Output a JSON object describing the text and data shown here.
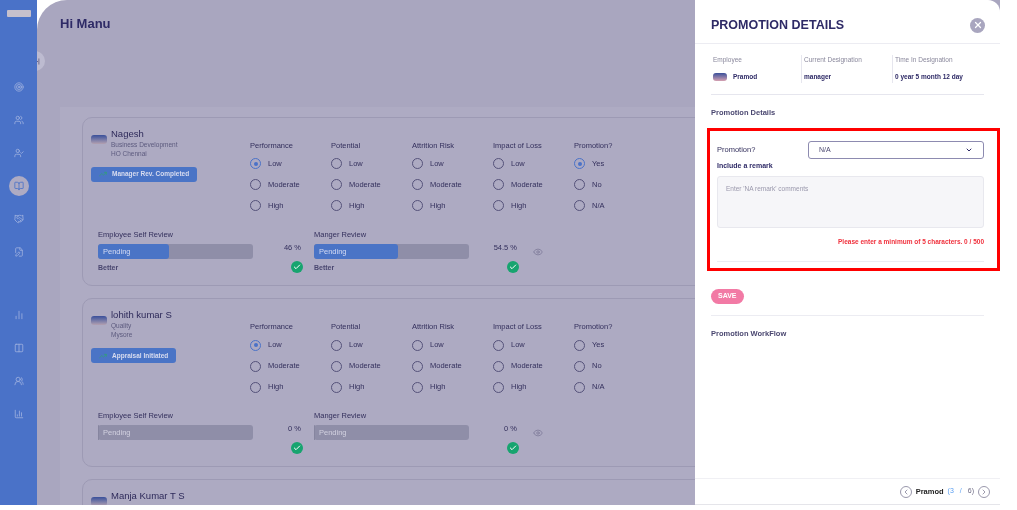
{
  "sidebar": {
    "items": [
      {
        "selected": false
      },
      {
        "selected": false
      },
      {
        "selected": false
      },
      {
        "selected": true
      },
      {
        "selected": false
      },
      {
        "selected": false
      },
      {
        "selected": false
      },
      {
        "selected": false
      },
      {
        "selected": false
      },
      {
        "selected": false
      }
    ]
  },
  "greeting": "Hi Manu",
  "employees": [
    {
      "name": "Nagesh",
      "department": "Business Development",
      "location": "HO Chennai",
      "status": "Manager Rev. Completed",
      "criteria": [
        {
          "title": "Performance",
          "options": [
            {
              "label": "Low",
              "selected": true
            },
            {
              "label": "Moderate",
              "selected": false
            },
            {
              "label": "High",
              "selected": false
            }
          ]
        },
        {
          "title": "Potential",
          "options": [
            {
              "label": "Low",
              "selected": false
            },
            {
              "label": "Moderate",
              "selected": false
            },
            {
              "label": "High",
              "selected": false
            }
          ]
        },
        {
          "title": "Attrition Risk",
          "options": [
            {
              "label": "Low",
              "selected": false
            },
            {
              "label": "Moderate",
              "selected": false
            },
            {
              "label": "High",
              "selected": false
            }
          ]
        },
        {
          "title": "Impact of Loss",
          "options": [
            {
              "label": "Low",
              "selected": false
            },
            {
              "label": "Moderate",
              "selected": false
            },
            {
              "label": "High",
              "selected": false
            }
          ]
        },
        {
          "title": "Promotion?",
          "options": [
            {
              "label": "Yes",
              "selected": true
            },
            {
              "label": "No",
              "selected": false
            },
            {
              "label": "N/A",
              "selected": false
            }
          ]
        }
      ],
      "reviews": [
        {
          "title": "Employee Self Review",
          "bar_label": "Pending",
          "level": 0.46,
          "percent": "46 %",
          "note": "Better"
        },
        {
          "title": "Manger Review",
          "bar_label": "Pending",
          "level": 0.545,
          "percent": "54.5 %",
          "note": "Better"
        }
      ]
    },
    {
      "name": "lohith kumar S",
      "department": "Quality",
      "location": "Mysore",
      "status": "Appraisal Initiated",
      "criteria": [
        {
          "title": "Performance",
          "options": [
            {
              "label": "Low",
              "selected": true
            },
            {
              "label": "Moderate",
              "selected": false
            },
            {
              "label": "High",
              "selected": false
            }
          ]
        },
        {
          "title": "Potential",
          "options": [
            {
              "label": "Low",
              "selected": false
            },
            {
              "label": "Moderate",
              "selected": false
            },
            {
              "label": "High",
              "selected": false
            }
          ]
        },
        {
          "title": "Attrition Risk",
          "options": [
            {
              "label": "Low",
              "selected": false
            },
            {
              "label": "Moderate",
              "selected": false
            },
            {
              "label": "High",
              "selected": false
            }
          ]
        },
        {
          "title": "Impact of Loss",
          "options": [
            {
              "label": "Low",
              "selected": false
            },
            {
              "label": "Moderate",
              "selected": false
            },
            {
              "label": "High",
              "selected": false
            }
          ]
        },
        {
          "title": "Promotion?",
          "options": [
            {
              "label": "Yes",
              "selected": false
            },
            {
              "label": "No",
              "selected": false
            },
            {
              "label": "N/A",
              "selected": false
            }
          ]
        }
      ],
      "reviews": [
        {
          "title": "Employee Self Review",
          "bar_label": "Pending",
          "level": 0,
          "percent": "0 %"
        },
        {
          "title": "Manger Review",
          "bar_label": "Pending",
          "level": 0,
          "percent": "0 %"
        }
      ]
    },
    {
      "name": "Manja Kumar T S"
    }
  ],
  "drawer": {
    "title": "PROMOTION DETAILS",
    "info": [
      {
        "label": "Employee",
        "value": "Pramod",
        "avatar": true
      },
      {
        "label": "Current Designation",
        "value": "manager"
      },
      {
        "label": "Time In Designation",
        "value": "0 year 5 month 12 day"
      }
    ],
    "section_title": "Promotion Details",
    "form": {
      "highlighted": true,
      "label": "Promotion?",
      "value": "N/A",
      "remark_label": "Include a remark",
      "placeholder": "Enter 'NA remark' comments",
      "error": "Please enter a minimum of 5 characters. 0 / 500"
    },
    "save": "SAVE",
    "workflow_title": "Promotion WorkFlow",
    "pager": {
      "name": "Pramod",
      "current": "(3",
      "separator": "/",
      "total": "6)"
    }
  }
}
